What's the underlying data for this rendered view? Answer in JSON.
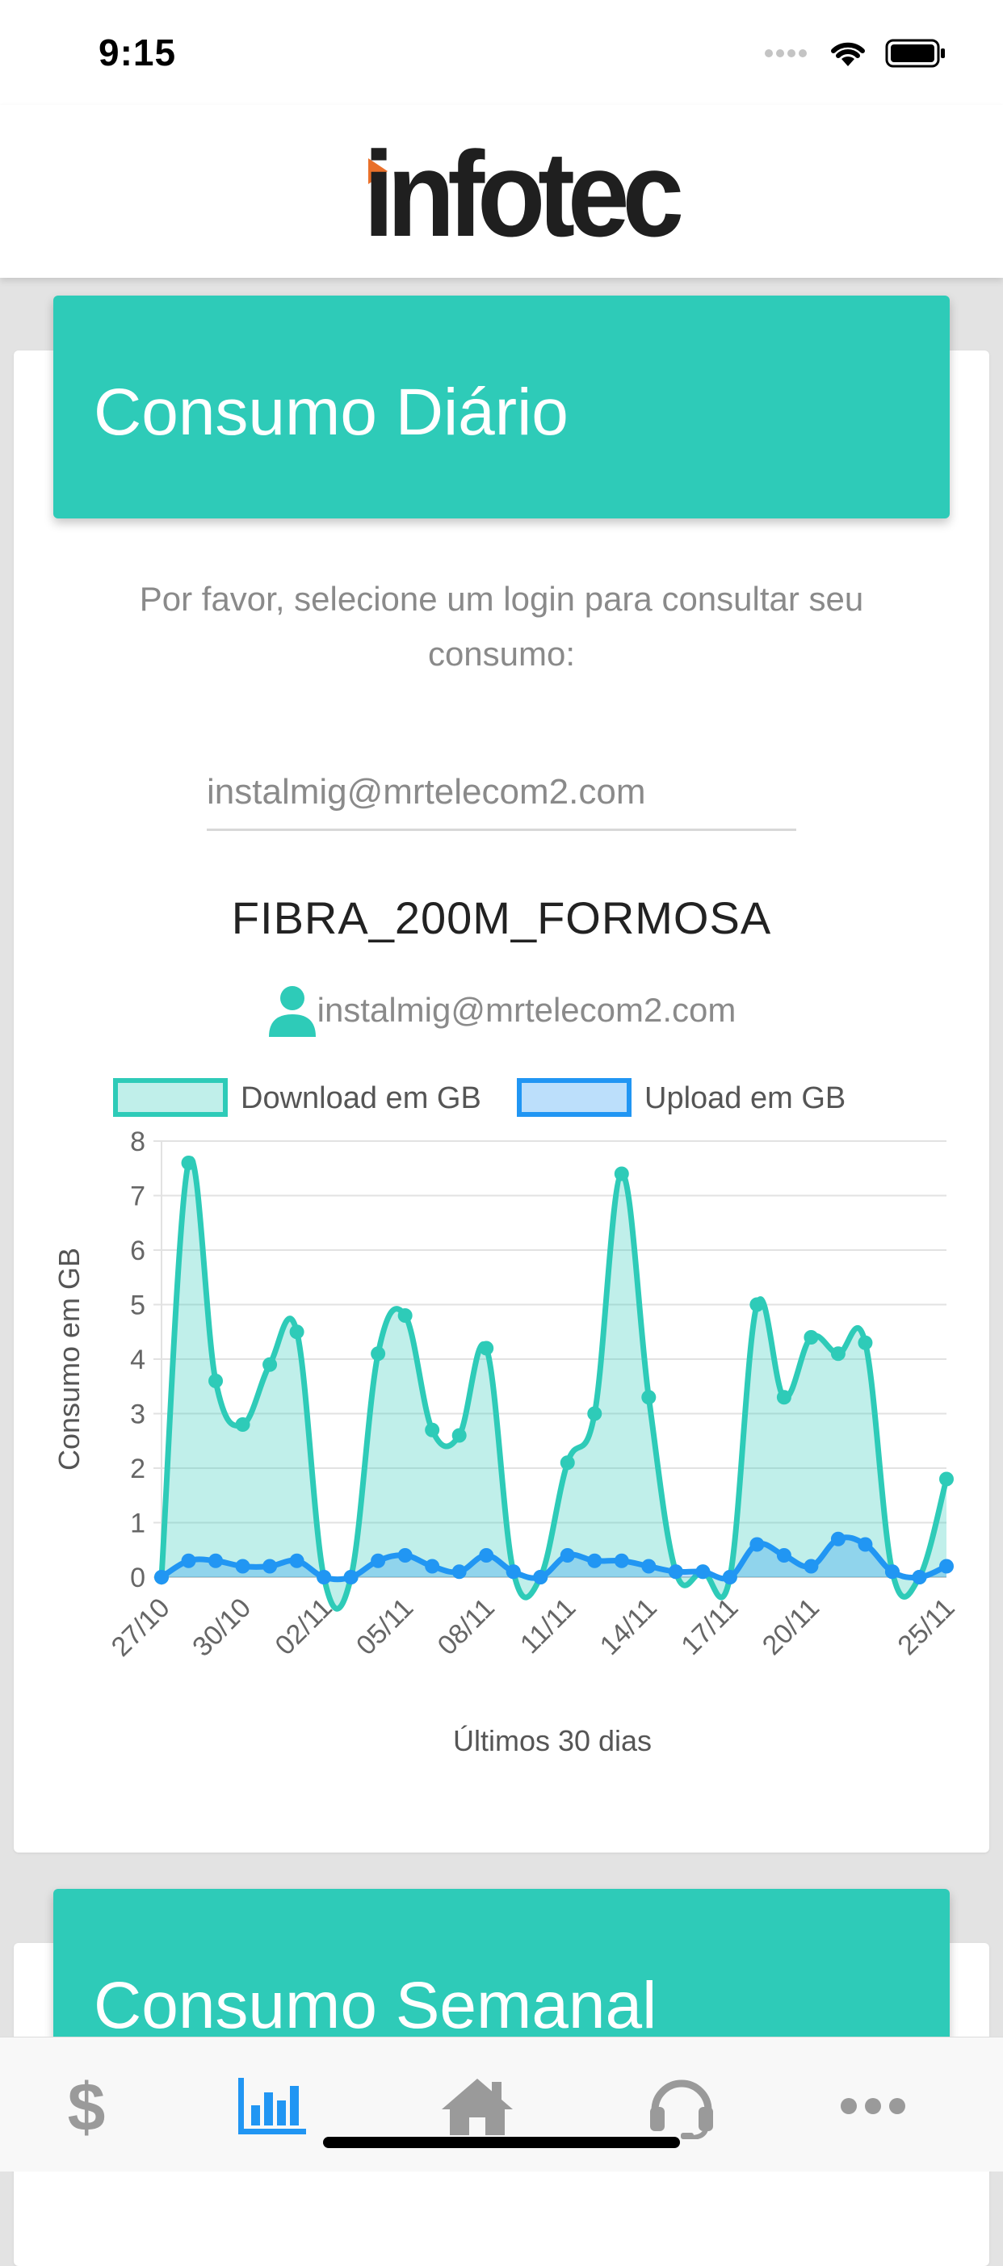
{
  "status_bar": {
    "time": "9:15"
  },
  "header": {
    "logo_text": "infotec"
  },
  "daily": {
    "title": "Consumo Diário",
    "instructions": "Por favor, selecione um login para consultar seu consumo:",
    "login_value": "instalmig@mrtelecom2.com",
    "plan_name": "FIBRA_200M_FORMOSA",
    "user_email": "instalmig@mrtelecom2.com"
  },
  "weekly": {
    "title": "Consumo Semanal"
  },
  "tab_bar": {
    "items": [
      {
        "name": "billing",
        "icon": "dollar-icon"
      },
      {
        "name": "consumption",
        "icon": "bar-chart-icon",
        "active": true
      },
      {
        "name": "home",
        "icon": "home-icon"
      },
      {
        "name": "support",
        "icon": "headset-icon"
      },
      {
        "name": "more",
        "icon": "more-icon"
      }
    ],
    "active_color": "#2196f3",
    "inactive_color": "#9a9a9a"
  },
  "colors": {
    "accent": "#2ecbb8",
    "download": "#2ecbb8",
    "upload": "#2196f3"
  },
  "chart_data": {
    "type": "area",
    "xlabel": "Últimos 30 dias",
    "ylabel": "Consumo em GB",
    "ylim": [
      0,
      8
    ],
    "yticks": [
      0,
      1,
      2,
      3,
      4,
      5,
      6,
      7,
      8
    ],
    "categories": [
      "27/10",
      "28/10",
      "29/10",
      "30/10",
      "31/10",
      "01/11",
      "02/11",
      "03/11",
      "04/11",
      "05/11",
      "06/11",
      "07/11",
      "08/11",
      "09/11",
      "10/11",
      "11/11",
      "12/11",
      "13/11",
      "14/11",
      "15/11",
      "16/11",
      "17/11",
      "18/11",
      "19/11",
      "20/11",
      "21/11",
      "22/11",
      "23/11",
      "24/11",
      "25/11"
    ],
    "tick_labels": [
      "27/10",
      "30/10",
      "02/11",
      "05/11",
      "08/11",
      "11/11",
      "14/11",
      "17/11",
      "20/11",
      "25/11"
    ],
    "legend_position": "top",
    "grid": true,
    "series": [
      {
        "name": "Download em GB",
        "color": "#2ecbb8",
        "fill": "rgba(46,203,184,0.3)",
        "values": [
          0.0,
          7.6,
          3.6,
          2.8,
          3.9,
          4.5,
          0.0,
          0.0,
          4.1,
          4.8,
          2.7,
          2.6,
          4.2,
          0.1,
          0.0,
          2.1,
          3.0,
          7.4,
          3.3,
          0.1,
          0.1,
          0.0,
          5.0,
          3.3,
          4.4,
          4.1,
          4.3,
          0.1,
          0.0,
          1.8
        ]
      },
      {
        "name": "Upload em GB",
        "color": "#2196f3",
        "fill": "rgba(33,150,243,0.3)",
        "values": [
          0.0,
          0.3,
          0.3,
          0.2,
          0.2,
          0.3,
          0.0,
          0.0,
          0.3,
          0.4,
          0.2,
          0.1,
          0.4,
          0.1,
          0.0,
          0.4,
          0.3,
          0.3,
          0.2,
          0.1,
          0.1,
          0.0,
          0.6,
          0.4,
          0.2,
          0.7,
          0.6,
          0.1,
          0.0,
          0.2
        ]
      }
    ]
  }
}
